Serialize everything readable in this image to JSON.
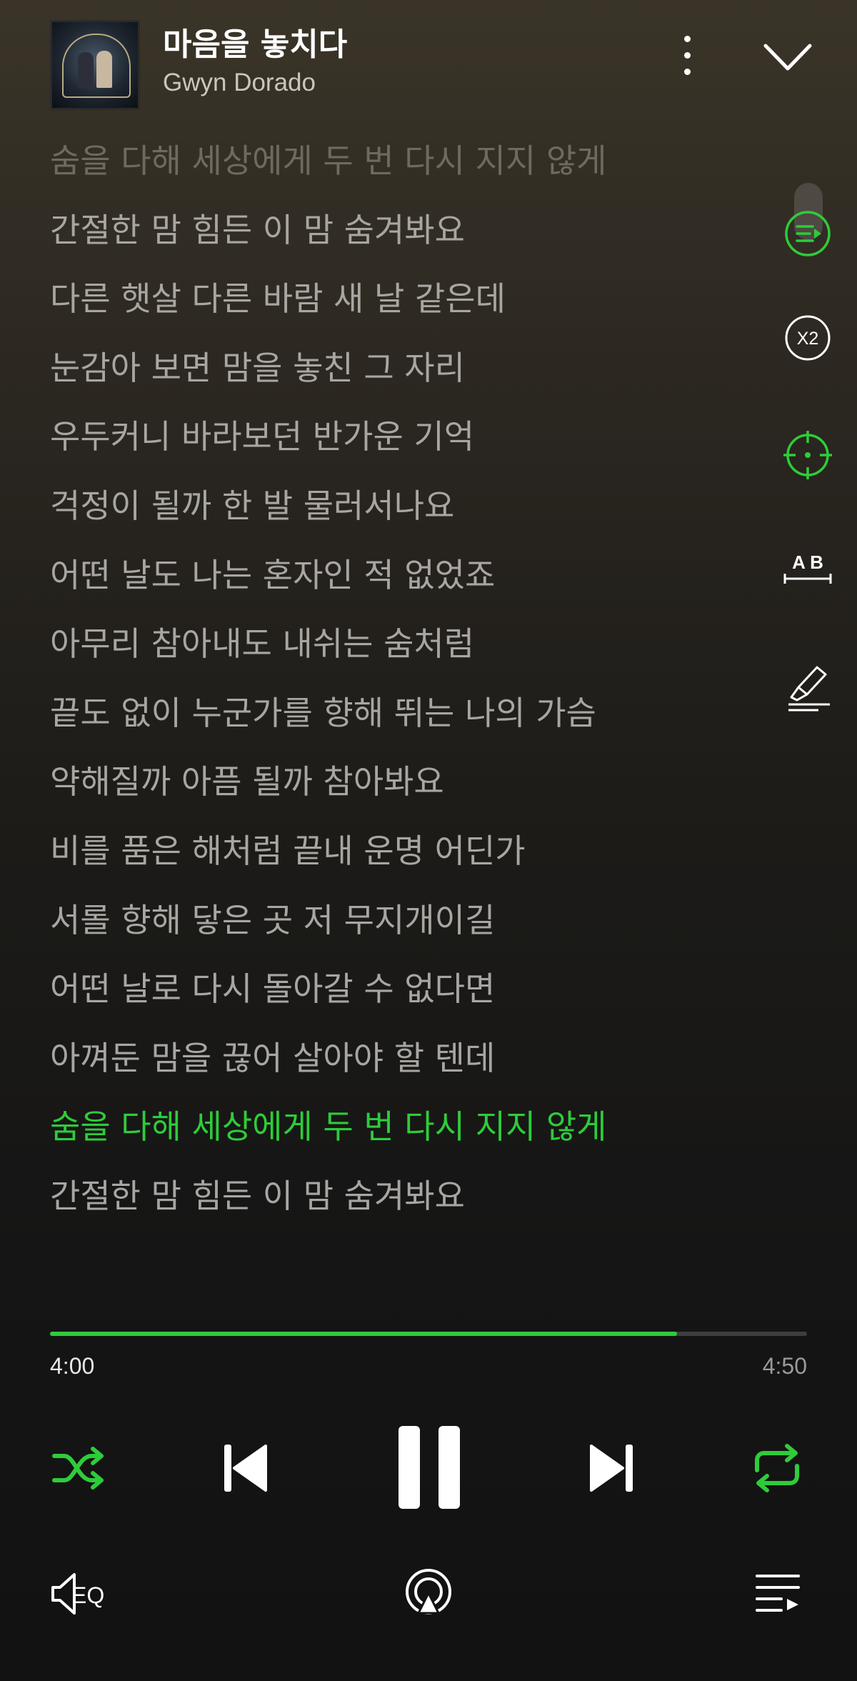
{
  "player": {
    "song_title": "마음을 놓치다",
    "artist": "Gwyn Dorado",
    "accent_color": "#2ecc3a"
  },
  "lyrics": [
    "숨을 다해 세상에게 두 번 다시 지지 않게",
    "간절한 맘 힘든 이 맘 숨겨봐요",
    "다른 햇살 다른 바람 새 날 같은데",
    "눈감아 보면 맘을 놓친 그 자리",
    "우두커니 바라보던 반가운 기억",
    "걱정이 될까 한 발 물러서나요",
    "어떤 날도 나는 혼자인 적 없었죠",
    "아무리 참아내도 내쉬는 숨처럼",
    "끝도 없이 누군가를 향해 뛰는 나의 가슴",
    "약해질까 아픔 될까 참아봐요",
    "비를 품은 해처럼 끝내 운명 어딘가",
    "서롤 향해 닿은 곳 저 무지개이길",
    "어떤 날로 다시 돌아갈 수 없다면",
    "아껴둔 맘을 끊어 살아야 할 텐데",
    "숨을 다해 세상에게 두 번 다시 지지 않게",
    "간절한 맘 힘든 이 맘 숨겨봐요"
  ],
  "active_lyric_index": 14,
  "side_tools": {
    "speed_label": "X2",
    "translate_label": "A B"
  },
  "playback": {
    "current_time": "4:00",
    "total_time": "4:50",
    "progress_fraction": 0.828
  },
  "bottom": {
    "eq_label": "EQ"
  },
  "icons": [
    "more-icon",
    "chevron-down-icon",
    "lyrics-sync-icon",
    "speed-icon",
    "locate-icon",
    "translate-icon",
    "highlight-icon",
    "shuffle-icon",
    "previous-icon",
    "pause-icon",
    "next-icon",
    "repeat-icon",
    "equalizer-icon",
    "cast-icon",
    "playlist-icon"
  ]
}
